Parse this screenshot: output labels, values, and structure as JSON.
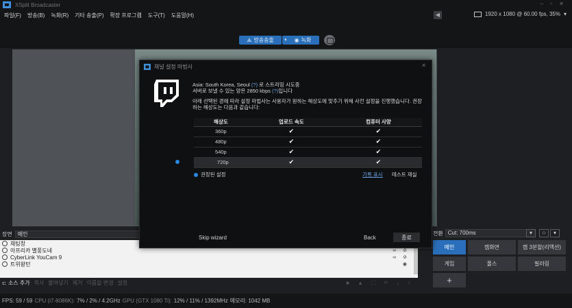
{
  "app": {
    "title": "XSplit Broadcaster"
  },
  "menu": [
    "파일(F)",
    "방송(B)",
    "녹화(R)",
    "기타 송출(P)",
    "확장 프로그램",
    "도구(T)",
    "도움말(H)"
  ],
  "status_resolution": "1920 x 1080 @ 60.00 fps, 35%",
  "toolbar": {
    "broadcast_label": "방송송출",
    "record_label": "녹화"
  },
  "scenes": {
    "label": "장면",
    "current": "메인"
  },
  "sources": [
    {
      "name": "채팅창"
    },
    {
      "name": "아프리카 별풍도네"
    },
    {
      "name": "CyberLink YouCam 9"
    },
    {
      "name": "트위왕턴"
    }
  ],
  "source_toolbar": {
    "add": "소스 추가",
    "copy": "복사",
    "paste": "붙여넣기",
    "remove": "제거",
    "rename": "이름을 변경",
    "settings": "설정"
  },
  "transition": {
    "label": "전환",
    "value": "Cut: 700ms"
  },
  "scene_buttons": [
    "메인",
    "캠화면",
    "캠 3분할(리액션)",
    "게임",
    "풀스",
    "필러링",
    "+"
  ],
  "statusbar": {
    "fps": "FPS:  59 / 59",
    "cpu_label": "CPU (i7-8086K):",
    "cpu": "7% / 2% / 4.2GHz",
    "gpu_label": "GPU (GTX 1080 Ti):",
    "gpu": "12% / 11% / 1392MHz",
    "mem": "메모리:  1042 MB"
  },
  "dialog": {
    "title": "채널 설정 마법사",
    "line1_pre": "Asia: South Korea, Seoul",
    "line1_hl": "(?)",
    "line1_post": "로 스트리밍 시도중",
    "line2_pre": "서버로 보낼 수 있는 양은 2850 kbps",
    "line2_hl": "(?)",
    "line2_post": "입니다",
    "line3": "아래 선택된 경에 따라 설정 마법사는 사용자가 원하는 해상도에 맞추기 위해 사전 설정을 진행했습니다. 권장하는 해상도는 다음과 같습니다:",
    "table": {
      "headers": [
        "해상도",
        "업로드 속도",
        "컴퓨터 사양"
      ],
      "rows": [
        {
          "res": "360p",
          "upload": "✔",
          "pc": "✔"
        },
        {
          "res": "480p",
          "upload": "✔",
          "pc": "✔"
        },
        {
          "res": "540p",
          "upload": "✔",
          "pc": "✔"
        },
        {
          "res": "720p",
          "upload": "✔",
          "pc": "✔"
        }
      ]
    },
    "legend": "권장된 설정",
    "show_log": "기록 표시",
    "retest": "테스트 재실",
    "skip": "Skip wizard",
    "back": "Back",
    "done": "종료"
  },
  "colors": {
    "accent": "#2a6fba",
    "link": "#6aa3e6",
    "bg": "#1e1f23"
  }
}
